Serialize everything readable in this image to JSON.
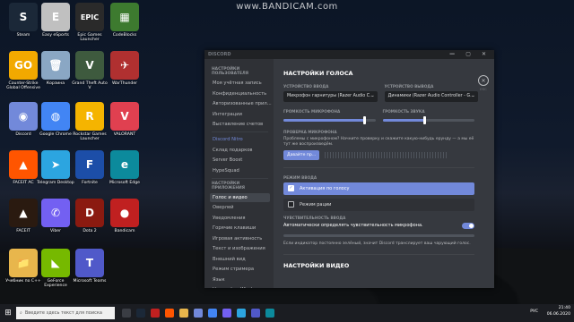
{
  "watermark": "www.BANDICAM.com",
  "desktop_icons": [
    {
      "label": "Steam",
      "glyph": "S",
      "color": "#1b2838",
      "icon": "steam-icon"
    },
    {
      "label": "Easy eSports",
      "glyph": "E",
      "color": "#c0c0c0",
      "icon": "easy-esports-icon"
    },
    {
      "label": "Epic Games Launcher",
      "glyph": "EPIC",
      "color": "#2a2a2a",
      "icon": "epic-games-icon"
    },
    {
      "label": "CodeBlocks",
      "glyph": "▦",
      "color": "#3d7a2f",
      "icon": "codeblocks-icon"
    },
    {
      "label": "Counter-Strike Global Offensive",
      "glyph": "GO",
      "color": "#f2a900",
      "icon": "csgo-icon"
    },
    {
      "label": "Корзина",
      "glyph": "🗑",
      "color": "#8aa7c4",
      "icon": "recycle-bin-icon"
    },
    {
      "label": "Grand Theft Auto V",
      "glyph": "V",
      "color": "#3e5a3e",
      "icon": "gta-v-icon"
    },
    {
      "label": "WarThunder",
      "glyph": "✈",
      "color": "#b03030",
      "icon": "warthunder-icon"
    },
    {
      "label": "Discord",
      "glyph": "◉",
      "color": "#7289da",
      "icon": "discord-icon"
    },
    {
      "label": "Google Chrome",
      "glyph": "◍",
      "color": "#4285f4",
      "icon": "chrome-icon"
    },
    {
      "label": "Rockstar Games Launcher",
      "glyph": "R",
      "color": "#f5b400",
      "icon": "rockstar-icon"
    },
    {
      "label": "VALORANT",
      "glyph": "V",
      "color": "#e04050",
      "icon": "valorant-icon"
    },
    {
      "label": "FACEIT AC",
      "glyph": "▲",
      "color": "#ff5500",
      "icon": "faceit-ac-icon"
    },
    {
      "label": "Telegram Desktop",
      "glyph": "➤",
      "color": "#2ca5e0",
      "icon": "telegram-icon"
    },
    {
      "label": "Fortnite",
      "glyph": "F",
      "color": "#1c4ea8",
      "icon": "fortnite-icon"
    },
    {
      "label": "Microsoft Edge",
      "glyph": "e",
      "color": "#0c8a9c",
      "icon": "edge-icon"
    },
    {
      "label": "FACEIT",
      "glyph": "▲",
      "color": "#2a1a10",
      "icon": "faceit-icon"
    },
    {
      "label": "Viber",
      "glyph": "✆",
      "color": "#7360f2",
      "icon": "viber-icon"
    },
    {
      "label": "Dota 2",
      "glyph": "D",
      "color": "#8b1a10",
      "icon": "dota2-icon"
    },
    {
      "label": "Bandicam",
      "glyph": "●",
      "color": "#c02020",
      "icon": "bandicam-icon"
    },
    {
      "label": "Учебник по C++",
      "glyph": "📁",
      "color": "#e8b64c",
      "icon": "folder-icon"
    },
    {
      "label": "GeForce Experience",
      "glyph": "◣",
      "color": "#76b900",
      "icon": "geforce-icon"
    },
    {
      "label": "Microsoft Teams",
      "glyph": "T",
      "color": "#5059c9",
      "icon": "teams-icon"
    }
  ],
  "discord": {
    "window_title": "DISCORD",
    "controls": "— ▢ ✕",
    "sidebar": {
      "user_settings_header": "НАСТРОЙКИ ПОЛЬЗОВАТЕЛЯ",
      "user_items": [
        "Моя учётная запись",
        "Конфиденциальность",
        "Авторизованные прил...",
        "Интеграции",
        "Выставление счетов"
      ],
      "nitro_items": [
        "Discord Nitro",
        "Склад подарков",
        "Server Boost",
        "HypeSquad"
      ],
      "app_settings_header": "НАСТРОЙКИ ПРИЛОЖЕНИЯ",
      "app_items": [
        "Голос и видео",
        "Оверлей",
        "Уведомления",
        "Горячие клавиши",
        "Игровая активность",
        "Текст и изображения",
        "Внешний вид",
        "Режим стримера",
        "Язык",
        "Настройки Windows"
      ]
    },
    "content": {
      "title": "НАСТРОЙКИ ГОЛОСА",
      "input_device_label": "УСТРОЙСТВО ВВОДА",
      "input_device_value": "Микрофон гарнитуры (Razer Audio C...",
      "output_device_label": "УСТРОЙСТВО ВЫВОДА",
      "output_device_value": "Динамики (Razer Audio Controller - G...",
      "mic_volume_label": "ГРОМКОСТЬ МИКРОФОНА",
      "mic_volume_level": 0.88,
      "sound_volume_label": "ГРОМКОСТЬ ЗВУКА",
      "sound_volume_level": 0.45,
      "mic_check_label": "ПРОВЕРКА МИКРОФОНА",
      "mic_check_desc": "Проблемы с микрофоном? Начните проверку и скажите какую-нибудь ерунду — а мы её тут же воспроизведём.",
      "mic_check_button": "Давайте пр...",
      "input_mode_label": "РЕЖИМ ВВОДА",
      "mode_voice": "Активация по голосу",
      "mode_ptt": "Режим рации",
      "sensitivity_label": "ЧУВСТВИТЕЛЬНОСТЬ ВВОДА",
      "auto_sensitivity": "Автоматически определять чувствительность микрофона.",
      "sensitivity_note": "Если индикатор постоянно зелёный, значит Discord транслирует ваш чарующий голос.",
      "video_title": "НАСТРОЙКИ ВИДЕО",
      "close_hint": "ESC"
    }
  },
  "taskbar": {
    "search_placeholder": "Введите здесь текст для поиска",
    "lang": "РУС",
    "time": "21:40",
    "date": "06.06.2020"
  }
}
